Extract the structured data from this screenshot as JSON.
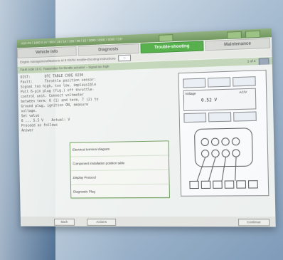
{
  "window": {
    "title": "AU1-01 / 1000 S Ar / 800 / 25 / 14 / 155 / 08 / 15 / 2000 / 0000 / 0000 / 237"
  },
  "tabs": [
    {
      "label": "Vehicle info",
      "active": false
    },
    {
      "label": "Diagnosis",
      "active": false
    },
    {
      "label": "Trouble-shooting",
      "active": true
    },
    {
      "label": "Maintenance",
      "active": false
    }
  ],
  "path": {
    "text": "Engine management/Motronic M 8.2/2/04 trouble-shooting instructions",
    "back_icon": "left-arrow-icon"
  },
  "subtitle": {
    "text": "Fault code 16 C: Transmitter for throttle actuator – Signal too high",
    "page": "1 of 4"
  },
  "content": {
    "lines": [
      "DIST:       DTC TABLE CODE 0230",
      "",
      "Fault:      Throttle position sensor:",
      "Signal too high, too low, implausible",
      "",
      "Pull 6-pin plug (fig.) off throttle-",
      "control unit. Connect voltmeter",
      "between term. 6 (1) and term. 7 (2) to",
      "Ground plug, ignition ON, measure",
      "voltage.",
      "Set value",
      "6 ... 5.5 V    Actual: V",
      "",
      "Proceed as follows",
      "",
      "Answer"
    ]
  },
  "menu_popup": {
    "items": [
      "Electrical terminal diagram",
      "Component installation position table",
      "Display Protocol",
      "Diagnostic Plug"
    ]
  },
  "diagram": {
    "voltage_label": "Voltage",
    "value": "0.52 V",
    "unit": "AC/V"
  },
  "footer": {
    "back_label": "Back",
    "actions_label": "Actions",
    "continue_label": "Continue"
  },
  "colors": {
    "accent_green": "#4fae41",
    "titlebar_green": "#7fa36a",
    "background_blue": "#2c4f74"
  }
}
